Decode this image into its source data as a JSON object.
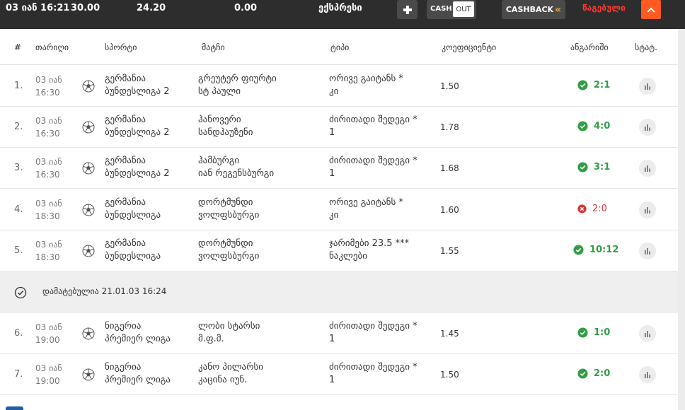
{
  "topbar": {
    "datetime": "03 იან 16:21",
    "stake": "30.00",
    "payout": "24.20",
    "win": "0.00",
    "bet_type": "ექსპრესი",
    "cash_label": "CASH",
    "out_label": "OUT",
    "cashback_label": "CASHBACK",
    "status": "წაგებული"
  },
  "header": {
    "num": "#",
    "date": "თარიღი",
    "sport": "სპორტი",
    "match": "მატჩი",
    "type": "ტიპი",
    "odd": "კოეფიციენტი",
    "result": "ანგარიში",
    "stat": "სტატ."
  },
  "rows": [
    {
      "num": "1.",
      "date1": "03 იან",
      "date2": "16:30",
      "sport1": "გერმანია",
      "sport2": "ბუნდესლიგა 2",
      "match1": "გრეუტერ ფიურტი",
      "match2": "სტ პაული",
      "type1": "ორივე გაიტანს *",
      "type2": "კი",
      "odd": "1.50",
      "score": "2:1",
      "outcome": "win"
    },
    {
      "num": "2.",
      "date1": "03 იან",
      "date2": "16:30",
      "sport1": "გერმანია",
      "sport2": "ბუნდესლიგა 2",
      "match1": "ჰანოვერი",
      "match2": "სანდჰაუზენი",
      "type1": "ძირითადი შედეგი *",
      "type2": "1",
      "odd": "1.78",
      "score": "4:0",
      "outcome": "win"
    },
    {
      "num": "3.",
      "date1": "03 იან",
      "date2": "16:30",
      "sport1": "გერმანია",
      "sport2": "ბუნდესლიგა 2",
      "match1": "ჰამბურგი",
      "match2": "იან რეგენსბურგი",
      "type1": "ძირითადი შედეგი *",
      "type2": "1",
      "odd": "1.68",
      "score": "3:1",
      "outcome": "win"
    },
    {
      "num": "4.",
      "date1": "03 იან",
      "date2": "18:30",
      "sport1": "გერმანია",
      "sport2": "ბუნდესლიგა",
      "match1": "დორტმუნდი",
      "match2": "ვოლფსბურგი",
      "type1": "ორივე გაიტანს *",
      "type2": "კი",
      "odd": "1.60",
      "score": "2:0",
      "outcome": "loss"
    },
    {
      "num": "5.",
      "date1": "03 იან",
      "date2": "18:30",
      "sport1": "გერმანია",
      "sport2": "ბუნდესლიგა",
      "match1": "დორტმუნდი",
      "match2": "ვოლფსბურგი",
      "type1": "ჯარიმები 23.5 ***",
      "type2": "ნაკლები",
      "odd": "1.55",
      "score": "10:12",
      "outcome": "win"
    },
    {
      "num": "6.",
      "date1": "03 იან",
      "date2": "19:00",
      "sport1": "ნიგერია",
      "sport2": "პრემიერ ლიგა",
      "match1": "ლობი სტარსი",
      "match2": "მ.ფ.მ.",
      "type1": "ძირითადი შედეგი *",
      "type2": "1",
      "odd": "1.45",
      "score": "1:0",
      "outcome": "win"
    },
    {
      "num": "7.",
      "date1": "03 იან",
      "date2": "19:00",
      "sport1": "ნიგერია",
      "sport2": "პრემიერ ლიგა",
      "match1": "კანო პილარსი",
      "match2": "კაცინა იუნ.",
      "type1": "ძირითადი შედეგი *",
      "type2": "1",
      "odd": "1.50",
      "score": "2:0",
      "outcome": "win"
    }
  ],
  "separator": {
    "text": "დამატებულია 21.01.03 16:24"
  },
  "colors": {
    "win": "#2f9e45",
    "loss": "#e03131",
    "accent": "#ff5a1f",
    "topbar": "#2d2d2d"
  }
}
